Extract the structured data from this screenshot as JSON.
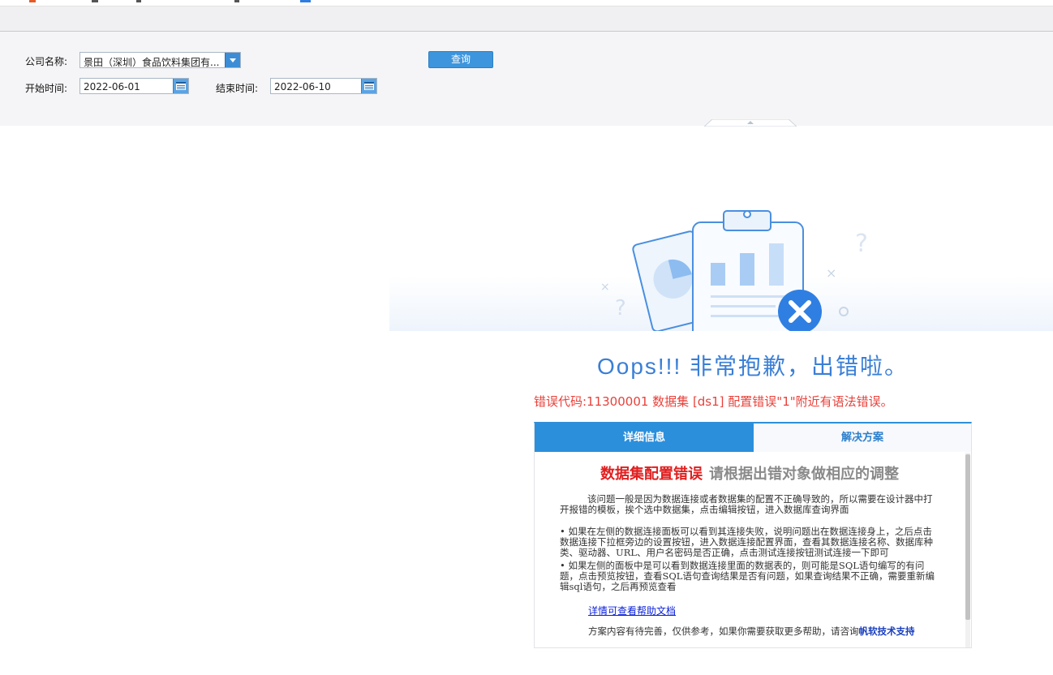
{
  "colors": {
    "accent": "#2b8fdc",
    "error_red": "#e8413a",
    "oops_blue": "#3a7fd6",
    "panel_bg": "#f5f5f7"
  },
  "params": {
    "company_label": "公司名称:",
    "company_value": "景田（深圳）食品饮料集团有...",
    "start_label": "开始时间:",
    "start_value": "2022-06-01",
    "end_label": "结束时间:",
    "end_value": "2022-06-10",
    "query_label": "查询"
  },
  "error": {
    "title": "Oops!!! 非常抱歉，出错啦。",
    "code_line": "错误代码:11300001 数据集 [ds1] 配置错误\"1\"附近有语法错误。",
    "tabs": [
      "详细信息",
      "解决方案"
    ],
    "heading_red": "数据集配置错误",
    "heading_grey": "请根据出错对象做相应的调整",
    "intro": "该问题一般是因为数据连接或者数据集的配置不正确导致的，所以需要在设计器中打开报错的模板，挨个选中数据集，点击编辑按钮，进入数据库查询界面",
    "bullet1": "• 如果在左侧的数据连接面板可以看到其连接失败，说明问题出在数据连接身上，之后点击数据连接下拉框旁边的设置按钮，进入数据连接配置界面，查看其数据连接名称、数据库种类、驱动器、URL、用户名密码是否正确，点击测试连接按钮测试连接一下即可",
    "bullet2": "• 如果左侧的面板中是可以看到数据连接里面的数据表的，则可能是SQL语句编写的有问题，点击预览按钮，查看SQL语句查询结果是否有问题，如果查询结果不正确，需要重新编辑sql语句，之后再预览查看",
    "help_link": "详情可查看帮助文档",
    "footnote": "方案内容有待完善，仅供参考，如果你需要获取更多帮助，请咨询",
    "support_link": "帆软技术支持"
  }
}
